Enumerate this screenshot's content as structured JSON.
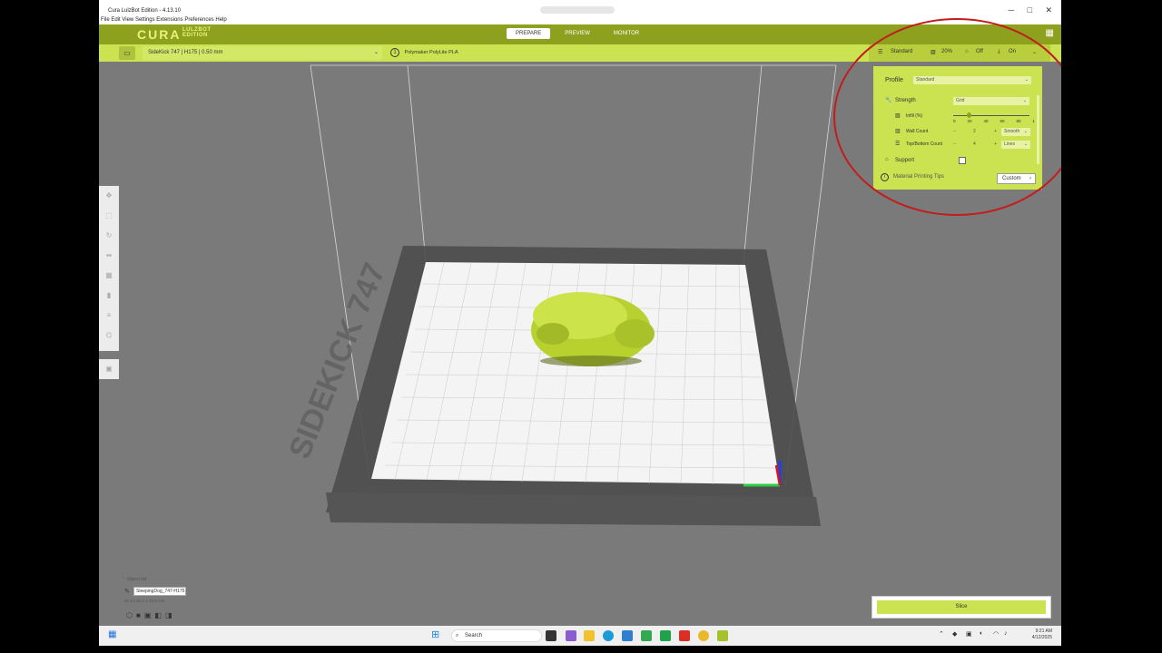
{
  "window": {
    "title": "Cura LulzBot Edition - 4.13.10"
  },
  "menu": [
    "File",
    "Edit",
    "View",
    "Settings",
    "Extensions",
    "Preferences",
    "Help"
  ],
  "logo": {
    "main": "CURA",
    "sub_line1": "LULZBOT",
    "sub_line2": "EDITION"
  },
  "stages": [
    {
      "label": "PREPARE",
      "active": true
    },
    {
      "label": "PREVIEW",
      "active": false
    },
    {
      "label": "MONITOR",
      "active": false
    }
  ],
  "toolbar": {
    "printer": "SideKick 747 | H175 | 0.50 mm",
    "material": "Polymaker PolyLite PLA"
  },
  "settings_summary": {
    "profile": "Standard",
    "infill": "20%",
    "support": "Off",
    "adhesion": "On"
  },
  "print_settings": {
    "profile_label": "Profile",
    "profile_value": "Standard",
    "strength_label": "Strength",
    "strength_value": "Grid",
    "infill_label": "Infill (%)",
    "infill_ticks": [
      "0",
      "20",
      "40",
      "60",
      "80",
      "1"
    ],
    "infill_value": 20,
    "wall_count_label": "Wall Count",
    "wall_count_value": "2",
    "wall_mode": "Smooth",
    "topbottom_label": "Top/Bottom Count",
    "topbottom_value": "4",
    "topbottom_mode": "Lines",
    "support_label": "Support",
    "support_checked": false,
    "tips_label": "Material Printing Tips",
    "custom_label": "Custom"
  },
  "object": {
    "list_label": "Object list",
    "name": "SleepingDog_747-H175",
    "dims": "61.8 x 80.2 x 35.9 mm"
  },
  "slice": {
    "label": "Slice"
  },
  "taskbar": {
    "search_placeholder": "Search",
    "time": "9:21 AM",
    "date": "4/12/2025"
  },
  "bed_text": "SIDEKICK 747",
  "colors": {
    "accent": "#cbe251",
    "topbar": "#8ea11e",
    "annotation": "#c21c1c"
  }
}
